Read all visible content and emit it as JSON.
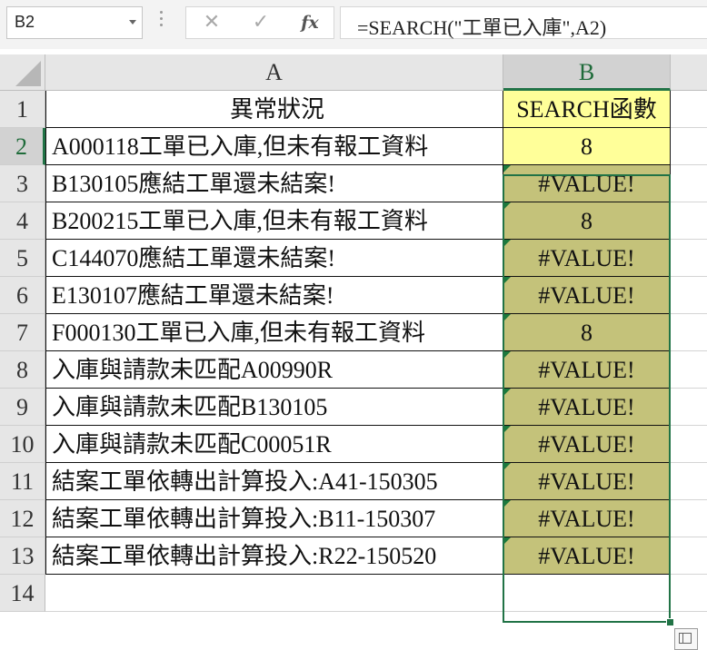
{
  "formula_bar": {
    "name_box": "B2",
    "cancel_icon": "✕",
    "enter_icon": "✓",
    "fx_label": "fx",
    "formula": "=SEARCH(\"工單已入庫\",A2)"
  },
  "columns": [
    "A",
    "B"
  ],
  "rows": [
    {
      "num": "1",
      "a": "異常狀況",
      "b": "SEARCH函數"
    },
    {
      "num": "2",
      "a": "A000118工單已入庫,但未有報工資料",
      "b": "8"
    },
    {
      "num": "3",
      "a": "B130105應結工單還未結案!",
      "b": "#VALUE!"
    },
    {
      "num": "4",
      "a": "B200215工單已入庫,但未有報工資料",
      "b": "8"
    },
    {
      "num": "5",
      "a": "C144070應結工單還未結案!",
      "b": "#VALUE!"
    },
    {
      "num": "6",
      "a": "E130107應結工單還未結案!",
      "b": "#VALUE!"
    },
    {
      "num": "7",
      "a": "F000130工單已入庫,但未有報工資料",
      "b": "8"
    },
    {
      "num": "8",
      "a": "入庫與請款未匹配A00990R",
      "b": "#VALUE!"
    },
    {
      "num": "9",
      "a": "入庫與請款未匹配B130105",
      "b": "#VALUE!"
    },
    {
      "num": "10",
      "a": "入庫與請款未匹配C00051R",
      "b": "#VALUE!"
    },
    {
      "num": "11",
      "a": "結案工單依轉出計算投入:A41-150305",
      "b": "#VALUE!"
    },
    {
      "num": "12",
      "a": "結案工單依轉出計算投入:B11-150307",
      "b": "#VALUE!"
    },
    {
      "num": "13",
      "a": "結案工單依轉出計算投入:R22-150520",
      "b": "#VALUE!"
    },
    {
      "num": "14",
      "a": "",
      "b": ""
    }
  ],
  "colors": {
    "header_fill": "#ffff99",
    "result_fill": "#c4c27a",
    "selection": "#217346"
  }
}
